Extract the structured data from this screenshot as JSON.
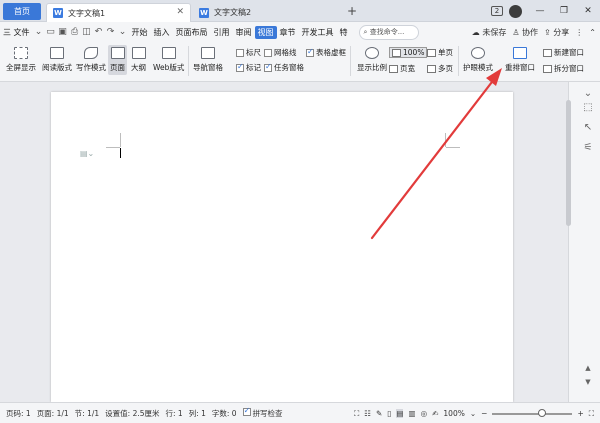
{
  "tabs": {
    "home": "首页",
    "doc1": "文字文稿1",
    "doc2": "文字文稿2",
    "new_tab": "+",
    "badge": "2"
  },
  "menu": {
    "file": "三 文件",
    "items": [
      "开始",
      "插入",
      "页面布局",
      "引用",
      "审阅",
      "视图",
      "章节",
      "开发工具",
      "特"
    ],
    "active": "视图",
    "search": "查找命令...",
    "unsaved": "未保存",
    "collab": "协作",
    "share": "分享"
  },
  "ribbon": {
    "fullscreen": "全屏显示",
    "reading": "阅读版式",
    "writing": "写作模式",
    "page": "页面",
    "outline": "大纲",
    "web": "Web版式",
    "nav_pane": "导航窗格",
    "ruler": "标尺",
    "gridlines": "网格线",
    "table_virtual": "表格虚框",
    "marks": "标记",
    "task_pane": "任务窗格",
    "display_ratio": "显示比例",
    "zoom_value": "100%",
    "single_page": "单页",
    "page_width": "页宽",
    "multi_page": "多页",
    "eye_protect": "护眼模式",
    "rearrange": "重排窗口",
    "new_window": "新建窗口",
    "split_window": "拆分窗口"
  },
  "status": {
    "page_no": "页码: 1",
    "pages": "页面: 1/1",
    "section": "节: 1/1",
    "setting": "设置值: 2.5厘米",
    "row": "行: 1",
    "col": "列: 1",
    "words": "字数: 0",
    "spell": "拼写检查",
    "zoom": "100%",
    "zoom_level": 0.62
  },
  "colors": {
    "accent": "#3a78d8",
    "annotation_arrow": "#e23b3b"
  }
}
